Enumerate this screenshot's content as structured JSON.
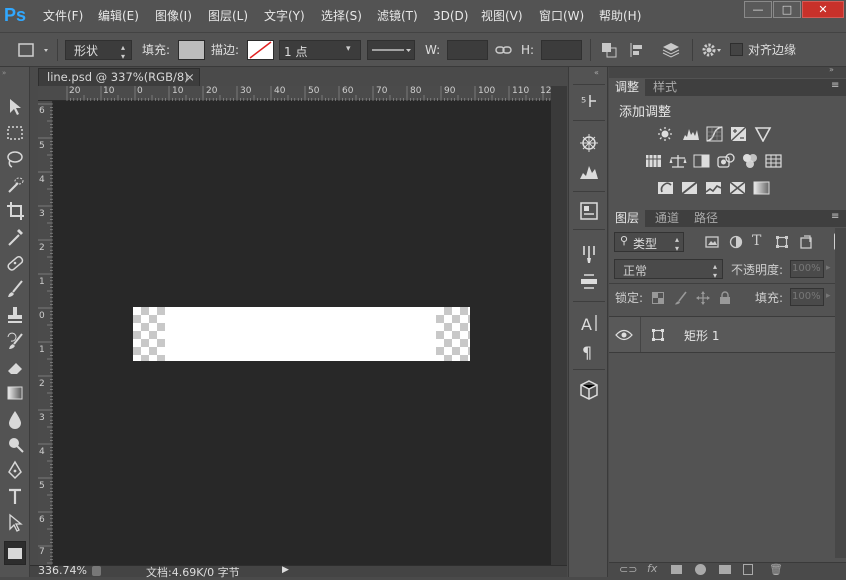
{
  "app": {
    "logo": "Ps"
  },
  "menu": [
    {
      "id": "file",
      "label": "文件(F)"
    },
    {
      "id": "edit",
      "label": "编辑(E)"
    },
    {
      "id": "image",
      "label": "图像(I)"
    },
    {
      "id": "layer",
      "label": "图层(L)"
    },
    {
      "id": "type",
      "label": "文字(Y)"
    },
    {
      "id": "select",
      "label": "选择(S)"
    },
    {
      "id": "filter",
      "label": "滤镜(T)"
    },
    {
      "id": "3d",
      "label": "3D(D)"
    },
    {
      "id": "view",
      "label": "视图(V)"
    },
    {
      "id": "window",
      "label": "窗口(W)"
    },
    {
      "id": "help",
      "label": "帮助(H)"
    }
  ],
  "window": {
    "minimize": "—",
    "restore": "□",
    "close": "✕"
  },
  "options": {
    "mode": "形状",
    "fill_label": "填充:",
    "stroke_label": "描边:",
    "stroke_width": "1 点",
    "w_label": "W:",
    "h_label": "H:",
    "align_edges": "对齐边缘"
  },
  "document": {
    "tab_title": "line.psd @ 337%(RGB/8)",
    "close": "×",
    "zoom": "336.74%",
    "doc_info": "文档:4.69K/0 字节"
  },
  "rulers": {
    "top": [
      "20",
      "10",
      "0",
      "10",
      "20",
      "30",
      "40",
      "50",
      "60",
      "70",
      "80",
      "90",
      "100",
      "110",
      "12"
    ],
    "left": [
      "6",
      "5",
      "4",
      "3",
      "2",
      "1",
      "0",
      "1",
      "2",
      "3",
      "4",
      "5",
      "6",
      "7"
    ]
  },
  "adjustments": {
    "tab": "调整",
    "styles_tab": "样式",
    "heading": "添加调整"
  },
  "layers": {
    "tabs": [
      "图层",
      "通道",
      "路径"
    ],
    "filter_kind": "类型",
    "blend_mode": "正常",
    "opacity_label": "不透明度:",
    "opacity": "100%",
    "lock_label": "锁定:",
    "fill_label": "填充:",
    "fill": "100%",
    "items": [
      {
        "name": "矩形 1",
        "visible": true
      }
    ]
  },
  "colors": {
    "accent": "#31a8ff",
    "close": "#c8312a"
  }
}
